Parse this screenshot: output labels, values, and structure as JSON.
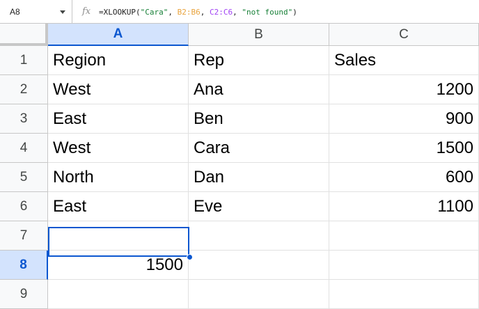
{
  "name_box": {
    "value": "A8"
  },
  "formula_bar": {
    "fx_label": "fx",
    "prefix": "=XLOOKUP(",
    "arg1": "\"Cara\"",
    "sep1": ", ",
    "arg2": "B2:B6",
    "sep2": ", ",
    "arg3": "C2:C6",
    "sep3": ", ",
    "arg4": "\"not found\"",
    "suffix": ")"
  },
  "columns": [
    "A",
    "B",
    "C"
  ],
  "rows": [
    "1",
    "2",
    "3",
    "4",
    "5",
    "6",
    "7",
    "8",
    "9"
  ],
  "cells": [
    [
      "Region",
      "Rep",
      "Sales"
    ],
    [
      "West",
      "Ana",
      "1200"
    ],
    [
      "East",
      "Ben",
      "900"
    ],
    [
      "West",
      "Cara",
      "1500"
    ],
    [
      "North",
      "Dan",
      "600"
    ],
    [
      "East",
      "Eve",
      "1100"
    ],
    [
      "",
      "",
      ""
    ],
    [
      "1500",
      "",
      ""
    ],
    [
      "",
      "",
      ""
    ]
  ],
  "selected_cell": "A8",
  "colors": {
    "selection": "#0b57d0",
    "header_selected_bg": "#d3e3fd"
  }
}
